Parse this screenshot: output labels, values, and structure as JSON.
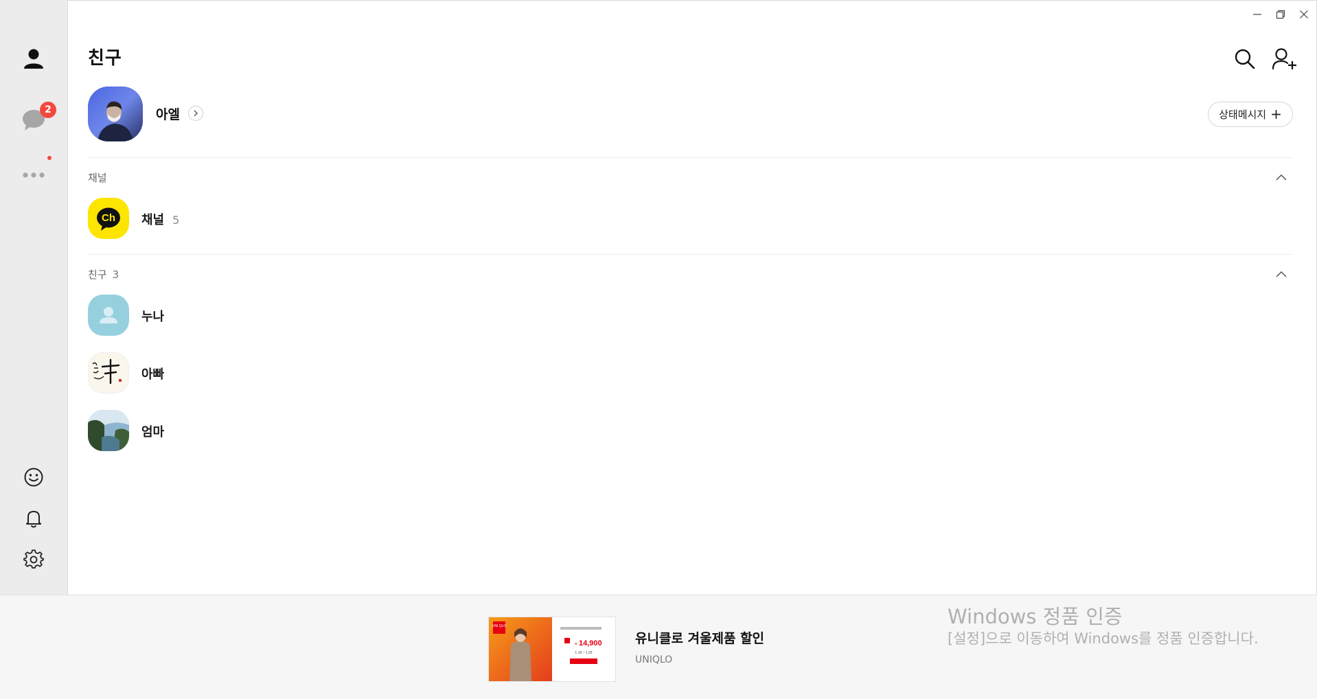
{
  "header": {
    "title": "친구"
  },
  "badges": {
    "chats_unread": "2"
  },
  "profile": {
    "name": "아엘",
    "status_button_label": "상태메시지",
    "status_button_plus": "+"
  },
  "sections": {
    "channel": {
      "label": "채널",
      "row_name": "채널",
      "row_count": "5"
    },
    "friends": {
      "label": "친구",
      "count": "3",
      "items": [
        {
          "name": "누나"
        },
        {
          "name": "아빠"
        },
        {
          "name": "엄마"
        }
      ]
    }
  },
  "ad": {
    "title": "유니클로 겨울제품 할인",
    "advertiser": "UNIQLO",
    "image_brand": "UNI QLO",
    "image_price": "14,900",
    "image_price_prefix": "w",
    "image_dates": "1.19 ~ 1.25"
  },
  "watermark": {
    "title": "Windows 정품 인증",
    "message": "[설정]으로 이동하여 Windows를 정품 인증합니다."
  },
  "colors": {
    "rail_bg": "#ececec",
    "badge_red": "#f3493d",
    "channel_yellow": "#fee500"
  }
}
